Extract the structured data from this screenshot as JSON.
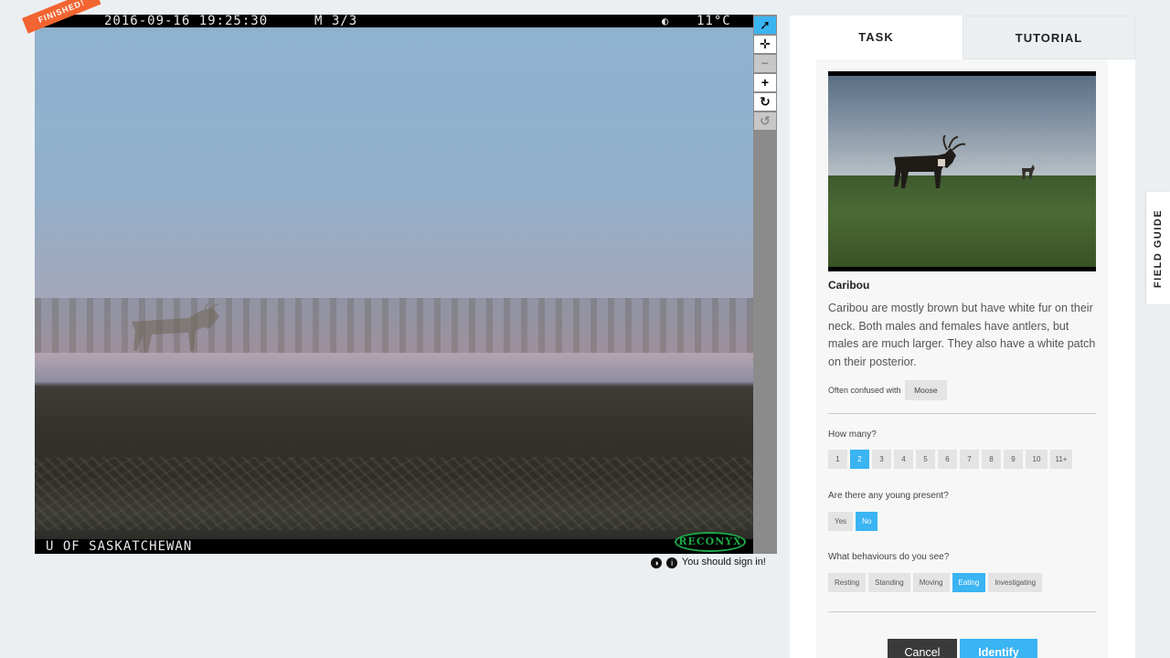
{
  "viewer": {
    "date_stamp": "2016-09-16 19:25:30",
    "frame_stamp": "M 3/3",
    "moon_icon": "◐",
    "temperature": "11°C",
    "owner_stamp": "U OF SASKATCHEWAN",
    "brand_logo": "RECONYX",
    "finished_label": "FINISHED!"
  },
  "tools": [
    {
      "name": "pointer-icon",
      "glyph": "➚"
    },
    {
      "name": "move-icon",
      "glyph": "✛"
    },
    {
      "name": "zoom-out-icon",
      "glyph": "−"
    },
    {
      "name": "zoom-in-icon",
      "glyph": "+"
    },
    {
      "name": "rotate-icon",
      "glyph": "↻"
    },
    {
      "name": "reset-icon",
      "glyph": "↺"
    }
  ],
  "signin": {
    "text": "You should sign in!",
    "contrast_icon": "◑",
    "info_icon": "i"
  },
  "tabs": {
    "task": "TASK",
    "tutorial": "TUTORIAL"
  },
  "species": {
    "name": "Caribou",
    "description": "Caribou are mostly brown but have white fur on their neck. Both males and females have antlers, but males are much larger. They also have a white patch on their posterior.",
    "confused_label": "Often confused with",
    "confused_with": "Moose"
  },
  "questions": {
    "how_many": {
      "label": "How many?",
      "options": [
        "1",
        "2",
        "3",
        "4",
        "5",
        "6",
        "7",
        "8",
        "9",
        "10",
        "11+"
      ],
      "selected": "2"
    },
    "young": {
      "label": "Are there any young present?",
      "options": [
        "Yes",
        "No"
      ],
      "selected": "No"
    },
    "behaviours": {
      "label": "What behaviours do you see?",
      "options": [
        "Resting",
        "Standing",
        "Moving",
        "Eating",
        "Investigating"
      ],
      "selected": "Eating"
    }
  },
  "actions": {
    "cancel": "Cancel",
    "identify": "Identify"
  },
  "field_guide": "FIELD GUIDE",
  "colors": {
    "accent": "#3ab4f2",
    "finished_badge": "#f26430",
    "dark_button": "#3a3a3a"
  }
}
